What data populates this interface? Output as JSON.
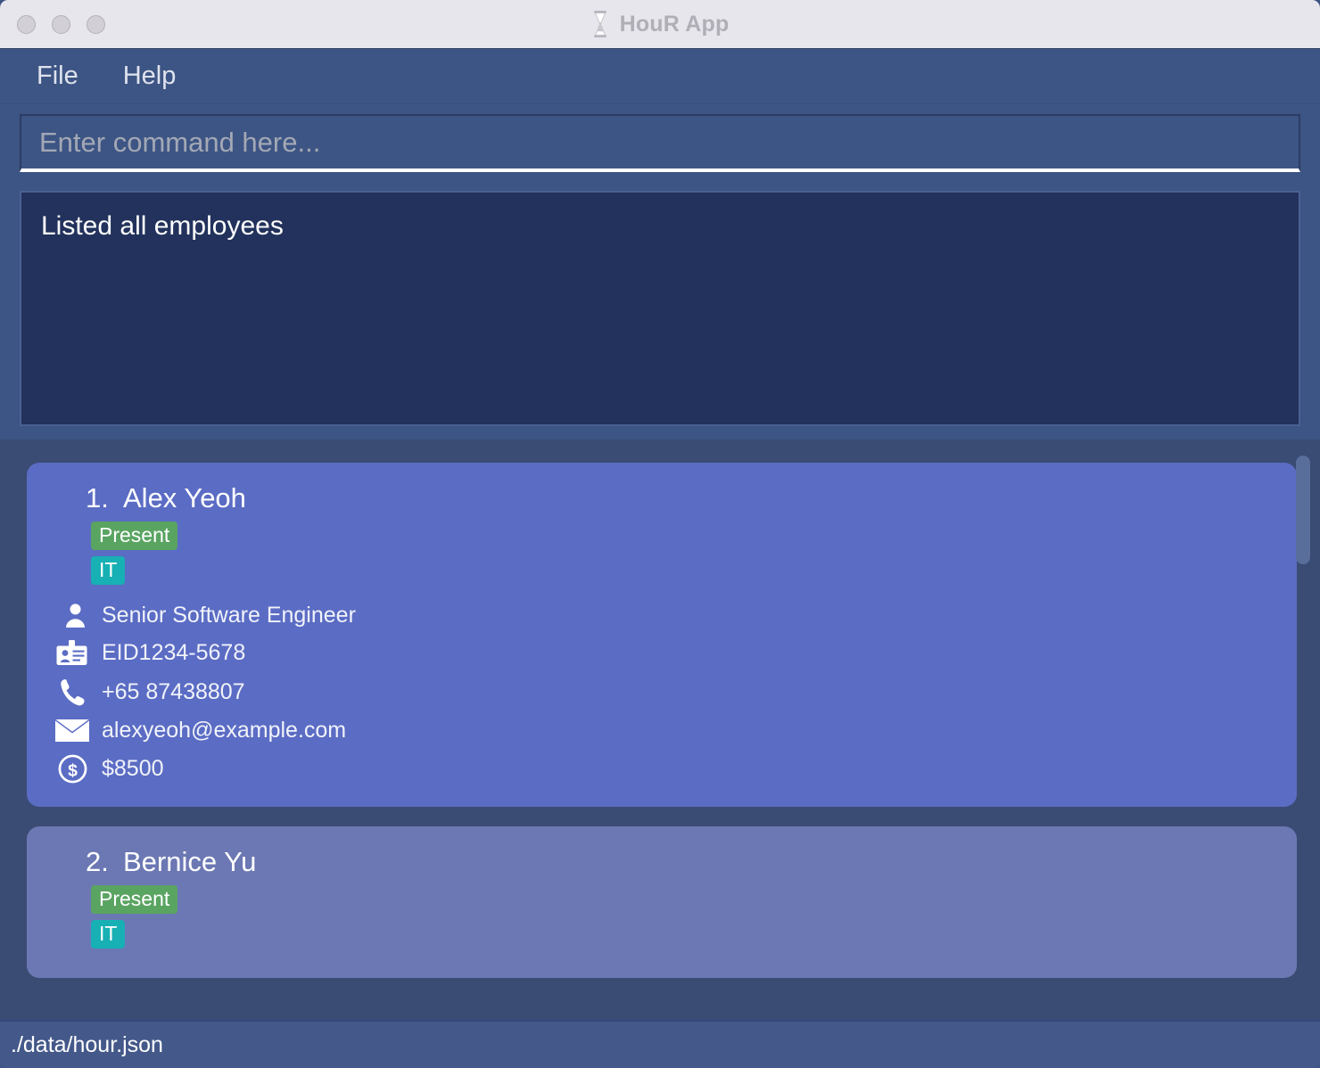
{
  "window": {
    "title": "HouR App",
    "app_icon": "hourglass-icon",
    "traffic_lights": [
      "close",
      "minimize",
      "maximize"
    ]
  },
  "menubar": {
    "items": [
      {
        "label": "File"
      },
      {
        "label": "Help"
      }
    ]
  },
  "command": {
    "placeholder": "Enter command here...",
    "value": ""
  },
  "result": {
    "text": "Listed all employees"
  },
  "employee_list": {
    "cards": [
      {
        "index": "1.",
        "name": "Alex Yeoh",
        "status_badge": "Present",
        "department_badge": "IT",
        "role": "Senior Software Engineer",
        "employee_id": "EID1234-5678",
        "phone": "+65 87438807",
        "email": "alexyeoh@example.com",
        "salary": "$8500"
      },
      {
        "index": "2.",
        "name": "Bernice Yu",
        "status_badge": "Present",
        "department_badge": "IT",
        "role": "",
        "employee_id": "",
        "phone": "",
        "email": "",
        "salary": ""
      }
    ]
  },
  "statusbar": {
    "path": "./data/hour.json"
  },
  "colors": {
    "app_background": "#3d5584",
    "titlebar": "#e8e6ed",
    "result_box": "#22325c",
    "list_panel": "#3a4c73",
    "card_primary": "#5b6cc4",
    "card_secondary": "#6c78b4",
    "badge_status_green": "#5aa462",
    "badge_dept_teal": "#17b0b4",
    "statusbar": "#44598a",
    "text_primary": "#ffffff",
    "placeholder": "#a3a8b5"
  }
}
